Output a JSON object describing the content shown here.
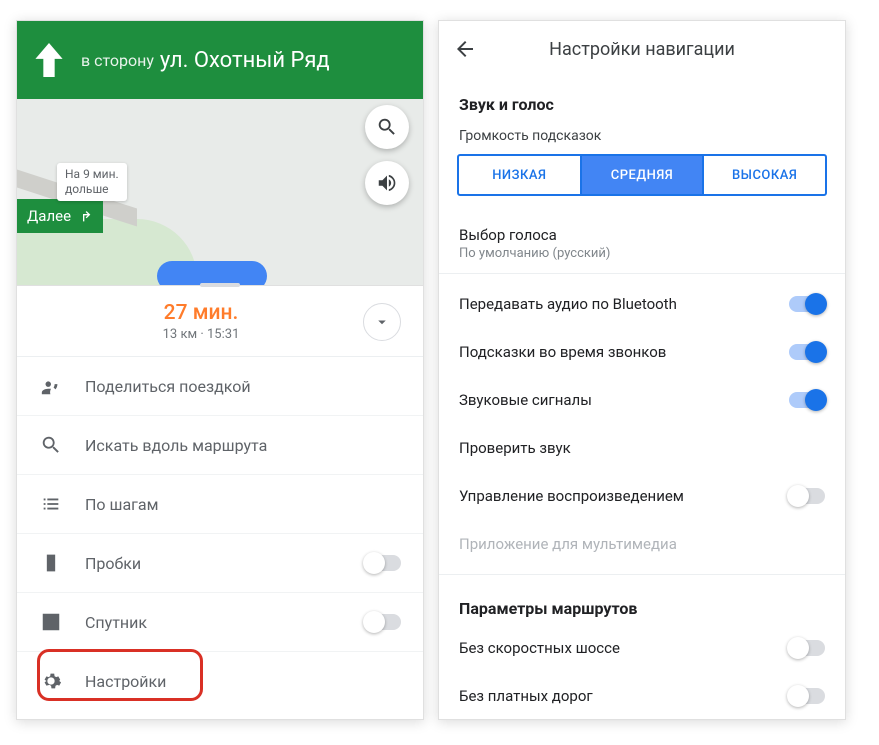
{
  "left": {
    "direction": {
      "prefix": "в сторону",
      "street": "ул. Охотный Ряд"
    },
    "next_label": "Далее",
    "map_info": "На 9 мин.\nдольше",
    "eta": {
      "time": "27 мин.",
      "distance": "13 км",
      "arrival": "15:31"
    },
    "menu": {
      "share": "Поделиться поездкой",
      "search_along": "Искать вдоль маршрута",
      "steps": "По шагам",
      "traffic": "Пробки",
      "satellite": "Спутник",
      "settings": "Настройки"
    }
  },
  "right": {
    "title": "Настройки навигации",
    "sound_section": "Звук и голос",
    "volume_label": "Громкость подсказок",
    "volume": {
      "low": "НИЗКАЯ",
      "medium": "СРЕДНЯЯ",
      "high": "ВЫСОКАЯ",
      "selected": "medium"
    },
    "voice": {
      "title": "Выбор голоса",
      "sub": "По умолчанию (русский)"
    },
    "prefs": {
      "bluetooth": "Передавать аудио по Bluetooth",
      "during_calls": "Подсказки во время звонков",
      "sound_signals": "Звуковые сигналы",
      "check_sound": "Проверить звук",
      "playback": "Управление воспроизведением",
      "media_app": "Приложение для мультимедиа"
    },
    "route_section": "Параметры маршрутов",
    "route": {
      "avoid_highways": "Без скоростных шоссе",
      "avoid_tolls": "Без платных дорог"
    },
    "toggles": {
      "bluetooth": true,
      "during_calls": true,
      "sound_signals": true,
      "playback": false,
      "avoid_highways": false,
      "avoid_tolls": false
    }
  }
}
